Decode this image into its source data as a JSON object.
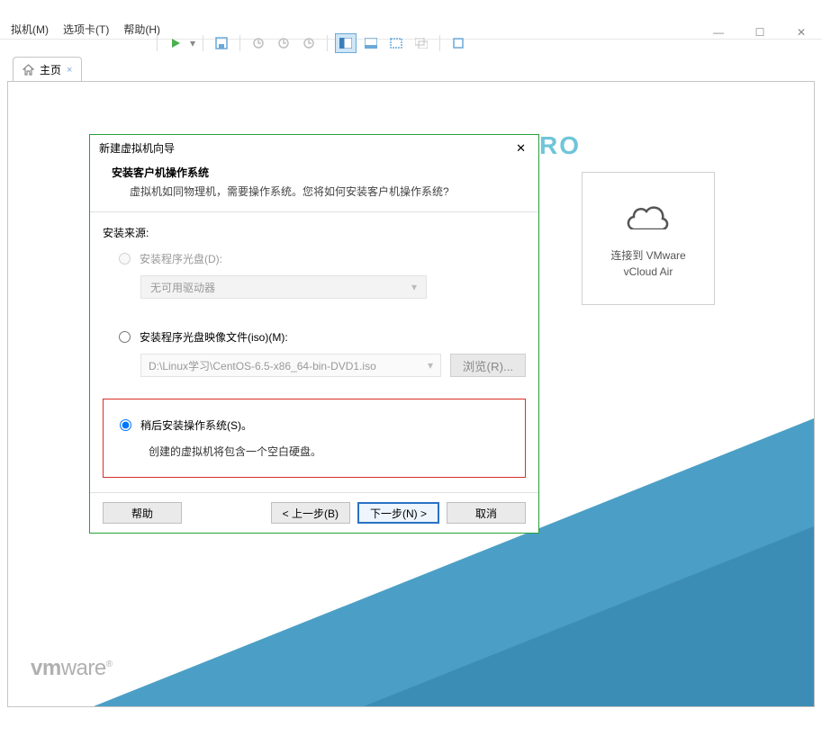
{
  "window_controls": {
    "min": "—",
    "max": "☐",
    "close": "✕"
  },
  "menubar": {
    "vm": "拟机(M)",
    "tabs": "选项卡(T)",
    "help": "帮助(H)"
  },
  "tab": {
    "label": "主页",
    "close": "×"
  },
  "logo_ro": "RO",
  "tile": {
    "label_l1": "连接到 VMware",
    "label_l2": "vCloud Air"
  },
  "vmware_logo_bold": "vm",
  "vmware_logo_rest": "ware",
  "dialog": {
    "title": "新建虚拟机向导",
    "close": "✕",
    "header_title": "安装客户机操作系统",
    "header_desc": "虚拟机如同物理机，需要操作系统。您将如何安装客户机操作系统?",
    "section_label": "安装来源:",
    "opt1_label": "安装程序光盘(D):",
    "dropdown_text": "无可用驱动器",
    "opt2_label": "安装程序光盘映像文件(iso)(M):",
    "iso_path": "D:\\Linux学习\\CentOS-6.5-x86_64-bin-DVD1.iso",
    "browse": "浏览(R)...",
    "opt3_label": "稍后安装操作系统(S)。",
    "opt3_desc": "创建的虚拟机将包含一个空白硬盘。",
    "btn_help": "帮助",
    "btn_back": "< 上一步(B)",
    "btn_next": "下一步(N) >",
    "btn_cancel": "取消"
  }
}
